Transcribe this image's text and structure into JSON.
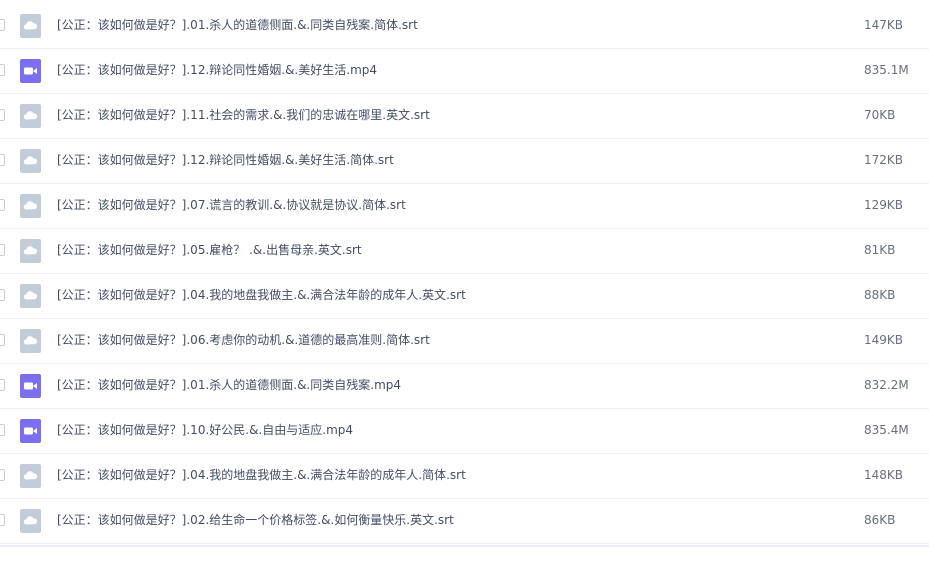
{
  "files": [
    {
      "name": "[公正：该如何做是好？].01.杀人的道德侧面.&.同类自残案.简体.srt",
      "size": "147KB",
      "type": "srt",
      "icon": "subtitle-file-icon"
    },
    {
      "name": "[公正：该如何做是好？].12.辩论同性婚姻.&.美好生活.mp4",
      "size": "835.1M",
      "type": "mp4",
      "icon": "video-file-icon"
    },
    {
      "name": "[公正：该如何做是好？].11.社会的需求.&.我们的忠诚在哪里.英文.srt",
      "size": "70KB",
      "type": "srt",
      "icon": "subtitle-file-icon"
    },
    {
      "name": "[公正：该如何做是好？].12.辩论同性婚姻.&.美好生活.简体.srt",
      "size": "172KB",
      "type": "srt",
      "icon": "subtitle-file-icon"
    },
    {
      "name": "[公正：该如何做是好？].07.谎言的教训.&.协议就是协议.简体.srt",
      "size": "129KB",
      "type": "srt",
      "icon": "subtitle-file-icon"
    },
    {
      "name": "[公正：该如何做是好？].05.雇枪？ .&.出售母亲.英文.srt",
      "size": "81KB",
      "type": "srt",
      "icon": "subtitle-file-icon"
    },
    {
      "name": "[公正：该如何做是好？].04.我的地盘我做主.&.满合法年龄的成年人.英文.srt",
      "size": "88KB",
      "type": "srt",
      "icon": "subtitle-file-icon"
    },
    {
      "name": "[公正：该如何做是好？].06.考虑你的动机.&.道德的最高准则.简体.srt",
      "size": "149KB",
      "type": "srt",
      "icon": "subtitle-file-icon"
    },
    {
      "name": "[公正：该如何做是好？].01.杀人的道德侧面.&.同类自残案.mp4",
      "size": "832.2M",
      "type": "mp4",
      "icon": "video-file-icon"
    },
    {
      "name": "[公正：该如何做是好？].10.好公民.&.自由与适应.mp4",
      "size": "835.4M",
      "type": "mp4",
      "icon": "video-file-icon"
    },
    {
      "name": "[公正：该如何做是好？].04.我的地盘我做主.&.满合法年龄的成年人.简体.srt",
      "size": "148KB",
      "type": "srt",
      "icon": "subtitle-file-icon"
    },
    {
      "name": "[公正：该如何做是好？].02.给生命一个价格标签.&.如何衡量快乐.英文.srt",
      "size": "86KB",
      "type": "srt",
      "icon": "subtitle-file-icon"
    }
  ],
  "colors": {
    "srt_icon": "#c3ccd9",
    "video_icon": "#7b6ff0",
    "text": "#424e67",
    "divider": "#eef2f6"
  }
}
